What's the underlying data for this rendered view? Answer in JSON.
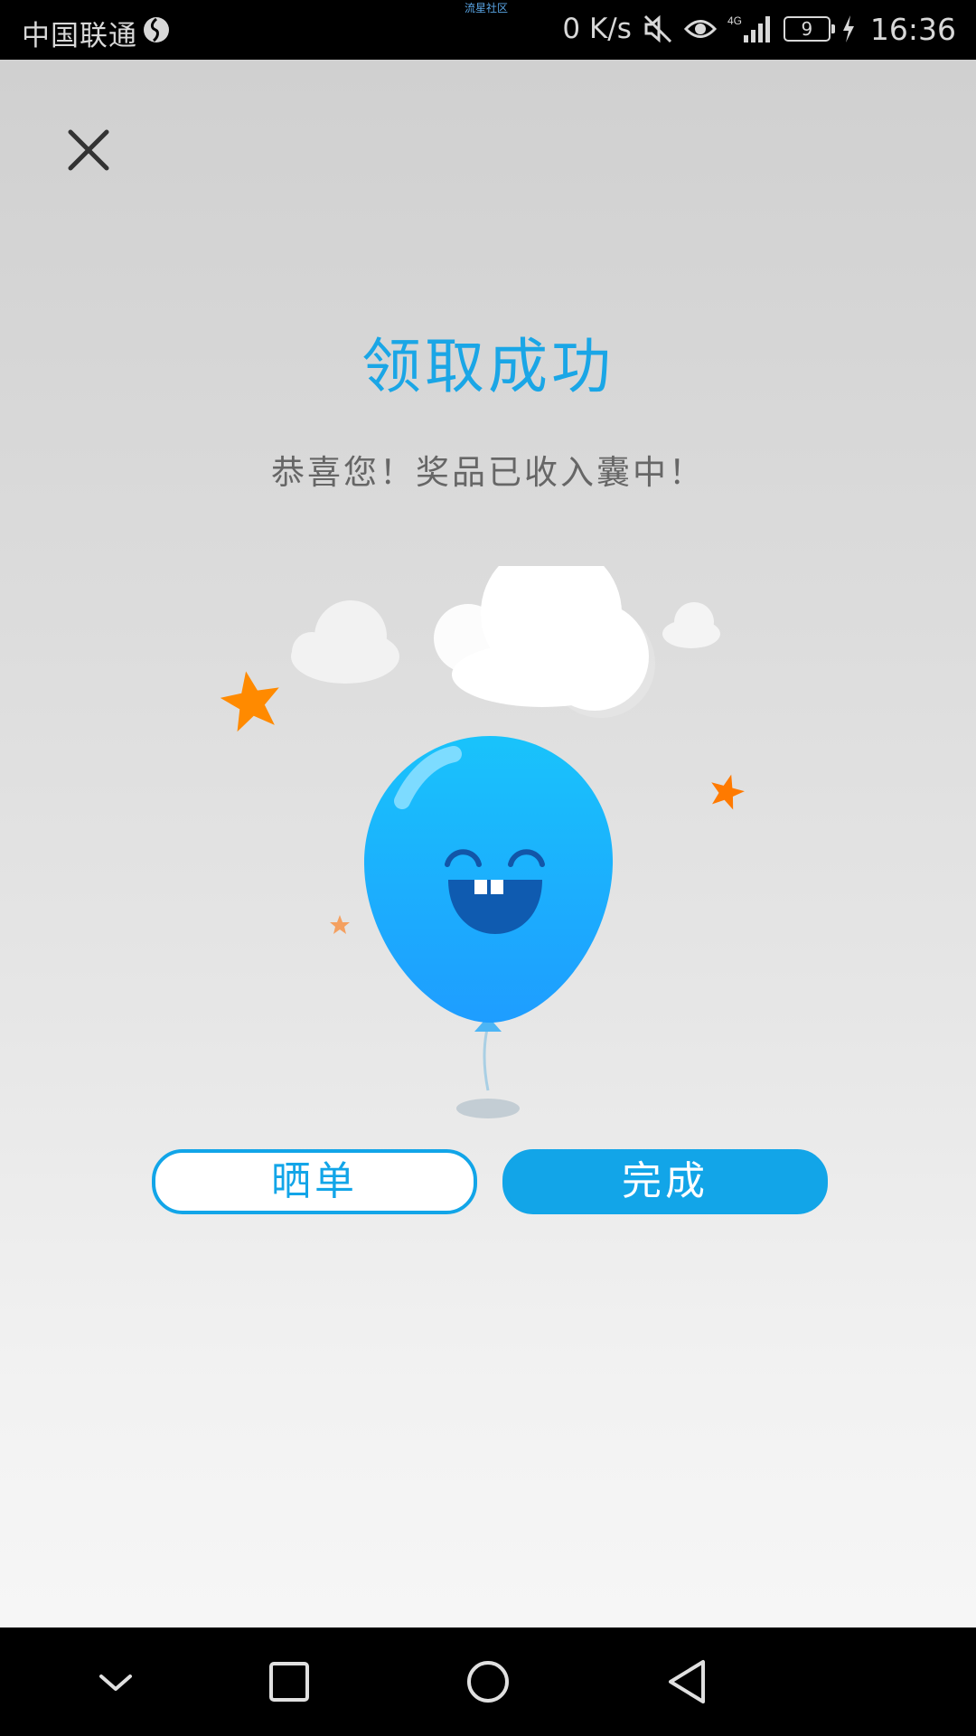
{
  "status_bar": {
    "carrier": "中国联通",
    "watermark": "流星社区",
    "net_speed": "0 K/s",
    "battery_level": "9",
    "time": "16:36",
    "icons": [
      "carrier-globe-icon",
      "mute-icon",
      "eye-icon",
      "4g-signal-icon",
      "battery-icon",
      "charging-icon"
    ]
  },
  "dialog": {
    "title": "领取成功",
    "message": "恭喜您！奖品已收入囊中！",
    "share_button": "晒单",
    "done_button": "完成",
    "close_icon": "close-icon"
  },
  "illustration": {
    "icons": [
      "balloon-icon",
      "cloud-icon",
      "star-icon"
    ]
  },
  "colors": {
    "accent": "#12a5e8",
    "title": "#1aa6e6",
    "star": "#ff8a00"
  },
  "nav_bar": {
    "icons": [
      "nav-down-icon",
      "recent-apps-icon",
      "home-icon",
      "back-icon"
    ]
  }
}
